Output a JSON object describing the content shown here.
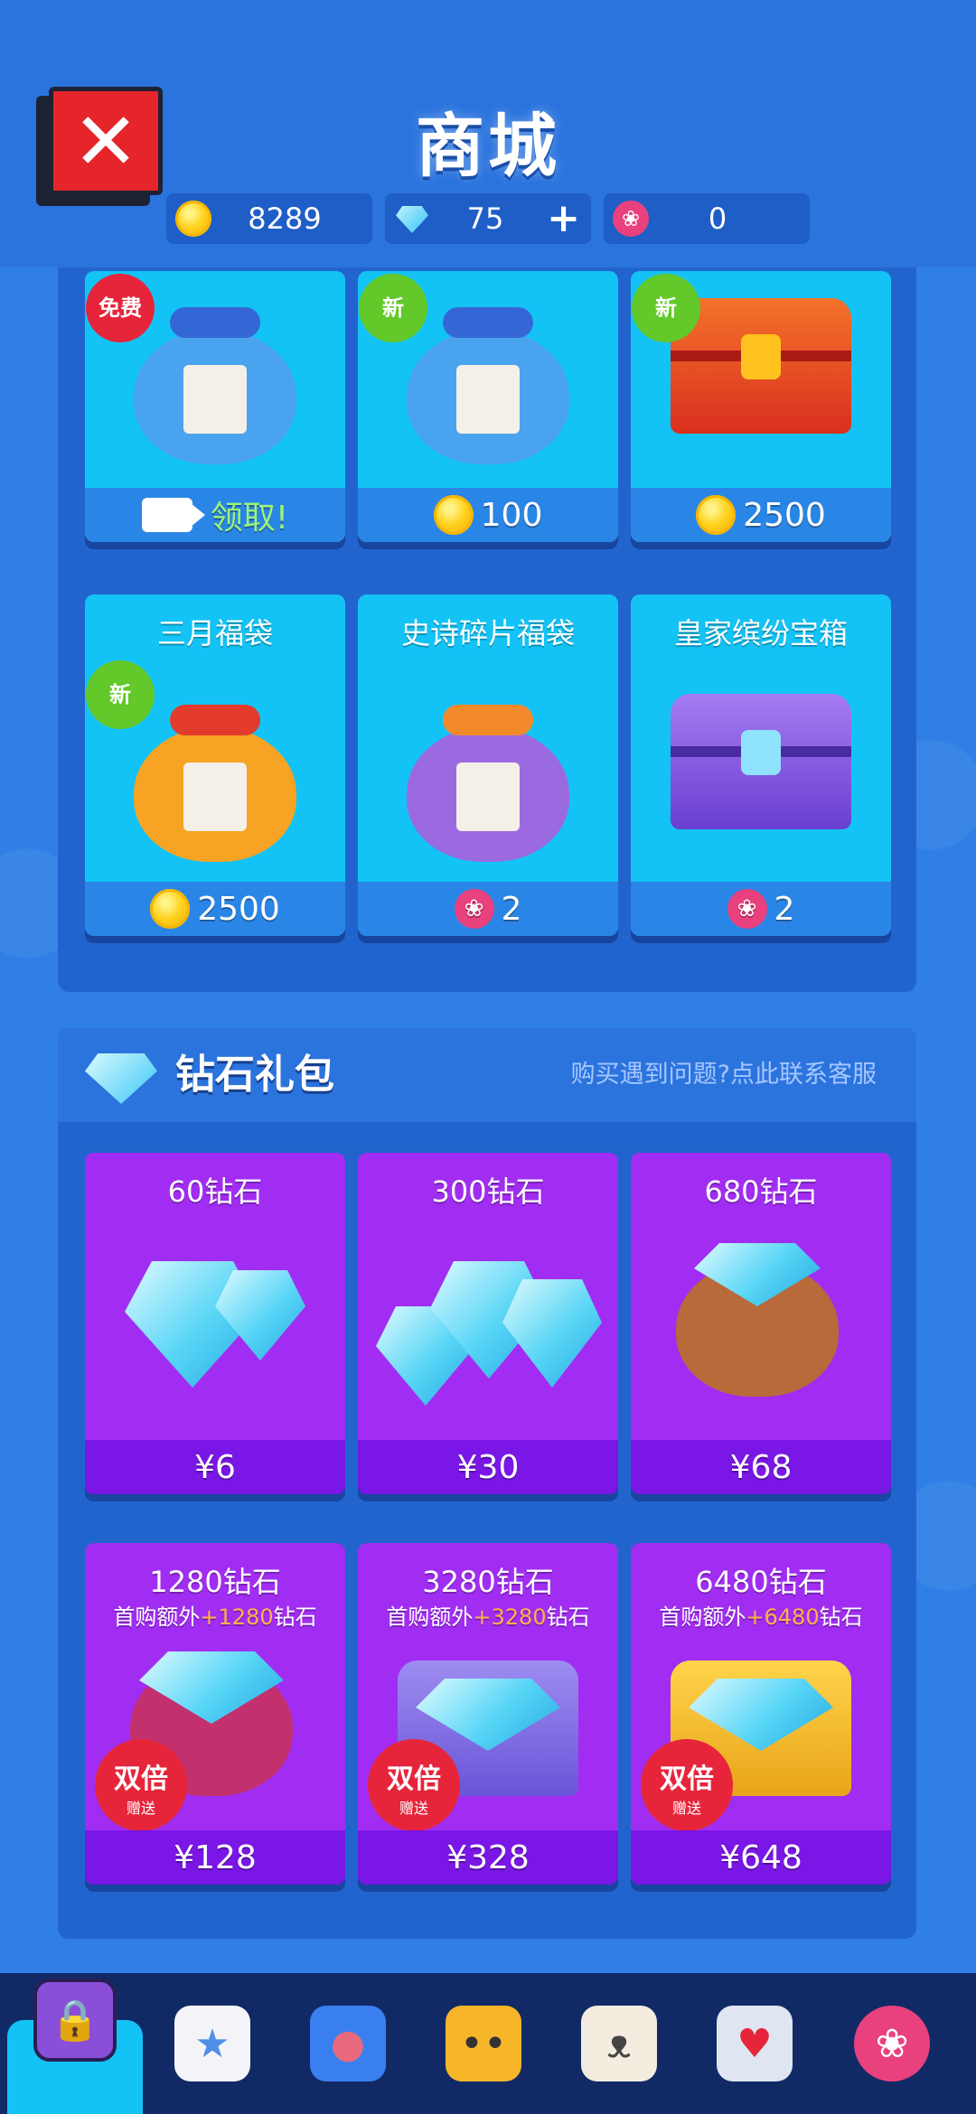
{
  "header": {
    "title": "商城",
    "close_icon": "close-icon",
    "currencies": {
      "coins": {
        "icon": "coin-icon",
        "value": "8289"
      },
      "gems": {
        "icon": "gem-icon",
        "value": "75",
        "add_label": "+"
      },
      "tulips": {
        "icon": "tulip-icon",
        "value": "0"
      }
    }
  },
  "shop": {
    "items": [
      {
        "name": "",
        "badge": "免费",
        "price_label": "领取!",
        "price_icon": "video-icon"
      },
      {
        "name": "",
        "badge": "新",
        "price_label": "100",
        "price_icon": "coin-icon"
      },
      {
        "name": "",
        "badge": "新",
        "price_label": "2500",
        "price_icon": "coin-icon"
      },
      {
        "name": "三月福袋",
        "badge": "新",
        "price_label": "2500",
        "price_icon": "coin-icon"
      },
      {
        "name": "史诗碎片福袋",
        "badge": "",
        "price_label": "2",
        "price_icon": "tulip-icon"
      },
      {
        "name": "皇家缤纷宝箱",
        "badge": "",
        "price_label": "2",
        "price_icon": "tulip-icon"
      }
    ]
  },
  "diamond_section": {
    "title": "钻石礼包",
    "help_link": "购买遇到问题?点此联系客服",
    "packs": [
      {
        "name": "60钻石",
        "price": "¥6"
      },
      {
        "name": "300钻石",
        "price": "¥30"
      },
      {
        "name": "680钻石",
        "price": "¥68"
      },
      {
        "name": "1280钻石",
        "bonus_prefix": "首购额外",
        "bonus_amount": "+1280",
        "bonus_suffix": "钻石",
        "badge_big": "双倍",
        "badge_small": "赠送",
        "price": "¥128"
      },
      {
        "name": "3280钻石",
        "bonus_prefix": "首购额外",
        "bonus_amount": "+3280",
        "bonus_suffix": "钻石",
        "badge_big": "双倍",
        "badge_small": "赠送",
        "price": "¥328"
      },
      {
        "name": "6480钻石",
        "bonus_prefix": "首购额外",
        "bonus_amount": "+6480",
        "bonus_suffix": "钻石",
        "badge_big": "双倍",
        "badge_small": "赠送",
        "price": "¥648"
      }
    ]
  },
  "bottom_nav": {
    "items": [
      {
        "icon": "chest-icon",
        "active": true
      },
      {
        "icon": "star-bubble-icon",
        "active": false
      },
      {
        "icon": "robot-icon",
        "active": false
      },
      {
        "icon": "chat-face-icon",
        "active": false
      },
      {
        "icon": "bunny-icon",
        "active": false
      },
      {
        "icon": "stamp-icon",
        "active": false
      },
      {
        "icon": "tulip-icon",
        "active": false
      }
    ]
  },
  "colors": {
    "background": "#2f7fe6",
    "card_blue": "#13c3f5",
    "card_purple": "#a12df2",
    "badge_red": "#e6253b",
    "badge_green": "#63c92a",
    "nav_bg": "#112a66"
  }
}
